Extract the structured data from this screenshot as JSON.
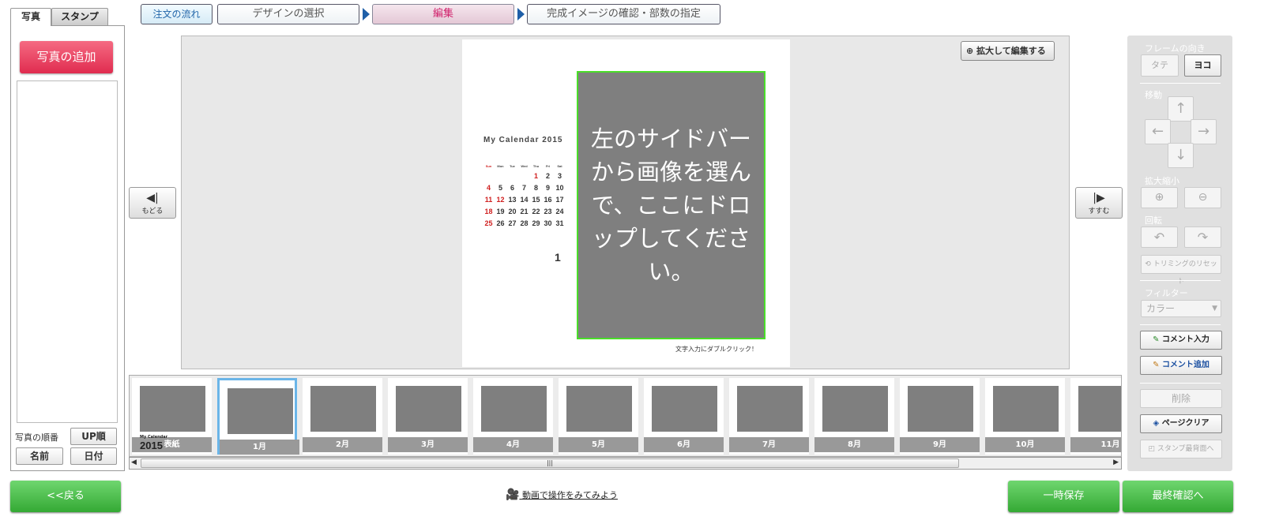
{
  "left_panel": {
    "tabs": [
      "写真",
      "スタンプ"
    ],
    "add_photo": "写真の追加",
    "sort_label": "写真の順番",
    "sort_buttons": [
      "UP順",
      "名前",
      "日付"
    ]
  },
  "steps": [
    "注文の流れ",
    "デザインの選択",
    "編集",
    "完成イメージの確認・部数の指定"
  ],
  "editor": {
    "zoom_edit": "拡大して編集する",
    "prev": "もどる",
    "next": "すすむ",
    "drop_hint": "左のサイドバーから画像を選んで、ここにドロップしてください。",
    "text_hint": "文字入力にダブルクリック！",
    "calendar": {
      "title": "My Calendar 2015",
      "weekdays": [
        "Sun",
        "Mon",
        "Tue",
        "Wed",
        "Thu",
        "Fri",
        "Sat"
      ],
      "days": [
        "",
        "",
        "",
        "",
        "1",
        "2",
        "3",
        "4",
        "5",
        "6",
        "7",
        "8",
        "9",
        "10",
        "11",
        "12",
        "13",
        "14",
        "15",
        "16",
        "17",
        "18",
        "19",
        "20",
        "21",
        "22",
        "23",
        "24",
        "25",
        "26",
        "27",
        "28",
        "29",
        "30",
        "31"
      ],
      "red_days": [
        "1",
        "4",
        "11",
        "12",
        "18",
        "25"
      ],
      "month": "1"
    }
  },
  "thumbnails": [
    {
      "label": "表紙",
      "cover_text": "2015",
      "cover_sub": "My Calendar"
    },
    {
      "label": "1月"
    },
    {
      "label": "2月"
    },
    {
      "label": "3月"
    },
    {
      "label": "4月"
    },
    {
      "label": "5月"
    },
    {
      "label": "6月"
    },
    {
      "label": "7月"
    },
    {
      "label": "8月"
    },
    {
      "label": "9月"
    },
    {
      "label": "10月"
    },
    {
      "label": "11月"
    }
  ],
  "right_panel": {
    "frame_dir_label": "フレームの向き",
    "tate": "タテ",
    "yoko": "ヨコ",
    "move_label": "移動",
    "scale_label": "拡大縮小",
    "rotate_label": "回転",
    "trim_reset": "トリミングのリセット",
    "filter_label": "フィルター",
    "filter_value": "カラー",
    "comment_input": "コメント入力",
    "comment_add": "コメント追加",
    "delete": "削除",
    "page_clear": "ページクリア",
    "stamp_back": "スタンプ最背面へ"
  },
  "bottom": {
    "back": "<<戻る",
    "video": "動画で操作をみてみよう",
    "temp_save": "一時保存",
    "final": "最終確認へ"
  },
  "colors": {
    "accent_pink": "#e02c4f",
    "green": "#34a934",
    "drop_border": "#4ade29"
  }
}
